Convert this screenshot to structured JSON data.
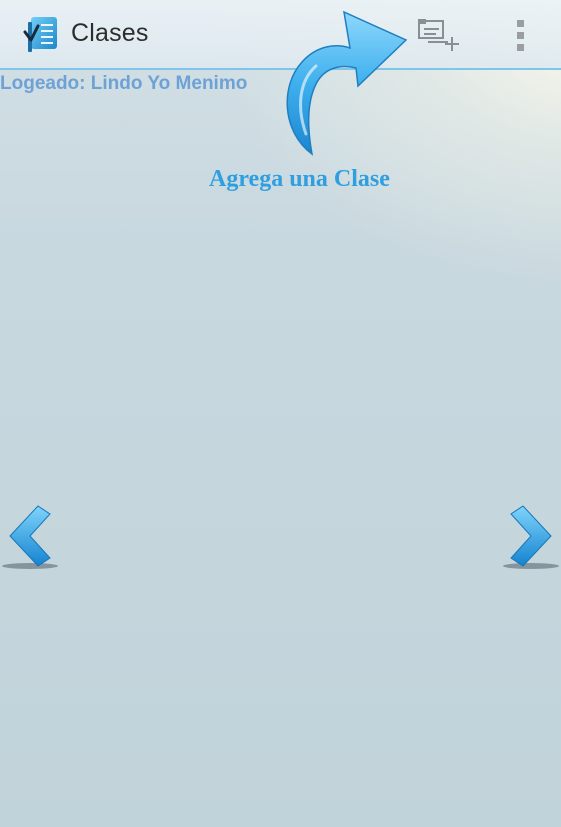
{
  "action_bar": {
    "title": "Clases",
    "app_icon": "checklist-notebook-icon",
    "actions": [
      {
        "icon": "add-class-icon"
      },
      {
        "icon": "overflow-menu-icon"
      }
    ]
  },
  "status": {
    "user_label": "Logeado: Lindo Yo Menimo"
  },
  "hint": {
    "text": "Agrega una Clase",
    "icon": "curved-arrow-icon"
  },
  "navigation": {
    "prev_icon": "chevron-left-icon",
    "next_icon": "chevron-right-icon"
  },
  "colors": {
    "accent": "#2f9fe0",
    "action_bar_divider": "#7fc4ea",
    "user_label": "#6ea2d4"
  }
}
